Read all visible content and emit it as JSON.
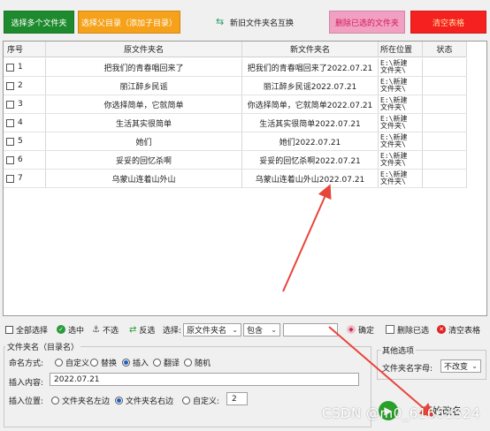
{
  "top_buttons": {
    "add_folders": "选择多个文件夹",
    "parent_dir": "选择父目录（添加子目录）",
    "swap_names": "新旧文件夹名互换",
    "delete_selected": "删除已选的文件夹",
    "clear_table": "清空表格"
  },
  "colors": {
    "add_folders": "#1e8a2e",
    "parent_dir": "#f5a11a",
    "delete_selected": "#f2a0c2",
    "clear_table": "#f52020",
    "annotation_arrow": "#e8453a"
  },
  "table": {
    "headers": [
      "序号",
      "原文件夹名",
      "新文件夹名",
      "所在位置",
      "状态"
    ],
    "rows": [
      {
        "no": "1",
        "old": "把我们的青春唱回来了",
        "new": "把我们的青春唱回来了2022.07.21",
        "loc": "E:\\新建\n文件夹\\",
        "status": ""
      },
      {
        "no": "2",
        "old": "丽江醉乡民谣",
        "new": "丽江醉乡民谣2022.07.21",
        "loc": "E:\\新建\n文件夹\\",
        "status": ""
      },
      {
        "no": "3",
        "old": "你选择简单，它就简单",
        "new": "你选择简单，它就简单2022.07.21",
        "loc": "E:\\新建\n文件夹\\",
        "status": ""
      },
      {
        "no": "4",
        "old": "生活其实很简单",
        "new": "生活其实很简单2022.07.21",
        "loc": "E:\\新建\n文件夹\\",
        "status": ""
      },
      {
        "no": "5",
        "old": "她们",
        "new": "她们2022.07.21",
        "loc": "E:\\新建\n文件夹\\",
        "status": ""
      },
      {
        "no": "6",
        "old": "妥妥的回忆杀啊",
        "new": "妥妥的回忆杀啊2022.07.21",
        "loc": "E:\\新建\n文件夹\\",
        "status": ""
      },
      {
        "no": "7",
        "old": "乌蒙山连着山外山",
        "new": "乌蒙山连着山外山2022.07.21",
        "loc": "E:\\新建\n文件夹\\",
        "status": ""
      }
    ]
  },
  "toolbar": {
    "select_all": "全部选择",
    "select": "选中",
    "unselect": "不选",
    "invert": "反选",
    "choose_label": "选择:",
    "field_dropdown": "原文件夹名",
    "op_dropdown": "包含",
    "filter_value": "",
    "confirm": "确定",
    "delete_checked": "删除已选",
    "clear_table": "清空表格"
  },
  "folder_group": {
    "title": "文件夹名（目录名）",
    "mode_label": "命名方式:",
    "modes": [
      "自定义",
      "替换",
      "插入",
      "翻译",
      "随机"
    ],
    "mode_selected": "插入",
    "content_label": "插入内容:",
    "content_value": "2022.07.21",
    "position_label": "插入位置:",
    "positions": [
      "文件夹名左边",
      "文件夹名右边",
      "自定义:"
    ],
    "position_selected": "文件夹名右边",
    "custom_pos_value": "2"
  },
  "other_group": {
    "title": "其他选项",
    "case_label": "文件夹名字母:",
    "case_value": "不改变"
  },
  "start_button": "开始改名",
  "watermark": "CSDN @m0_61661524",
  "icons": [
    "swap-icon",
    "select-icon",
    "unselect-icon",
    "invert-icon",
    "confirm-icon",
    "delete-icon",
    "clear-icon",
    "start-icon"
  ]
}
